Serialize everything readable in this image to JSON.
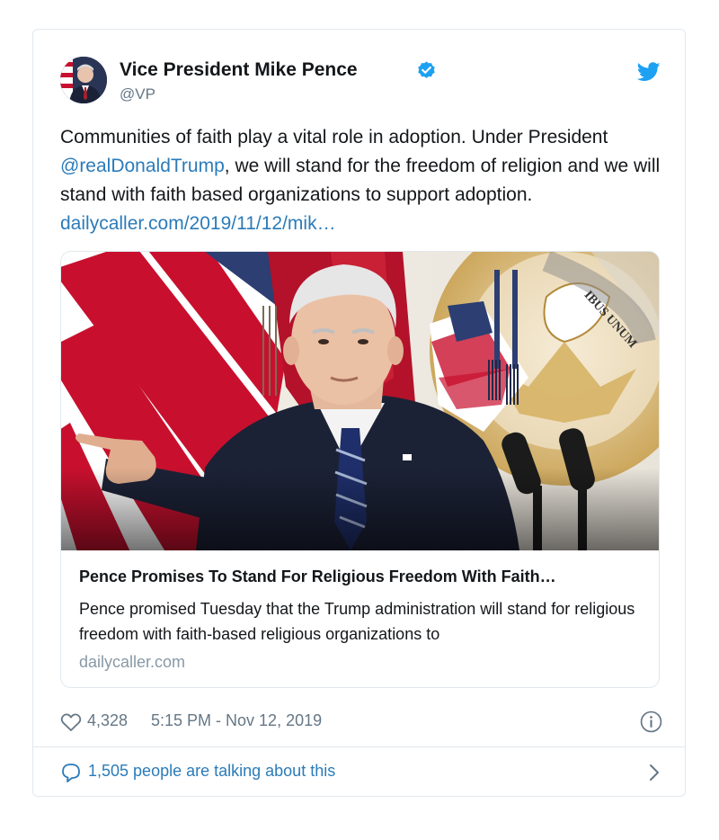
{
  "author": {
    "display_name": "Vice President Mike Pence",
    "handle": "@VP"
  },
  "tweet": {
    "text_part1": "Communities of faith play a vital role in adoption. Under President ",
    "mention": "@realDonaldTrump",
    "text_part2": ", we will stand for the freedom of religion and we will stand with faith based organizations to support adoption.  ",
    "link": "dailycaller.com/2019/11/12/mik…"
  },
  "card": {
    "title": "Pence Promises To Stand For Religious Freedom With Faith…",
    "description": "Pence promised Tuesday that the Trump administration will stand for religious freedom with faith-based religious organizations to",
    "domain": "dailycaller.com",
    "seal_text": "IBUS UNUM"
  },
  "meta": {
    "likes": "4,328",
    "timestamp": "5:15 PM - Nov 12, 2019"
  },
  "engagement": {
    "talking": "1,505 people are talking about this"
  },
  "colors": {
    "link": "#2b7bb9",
    "verified": "#1da1f2",
    "twitter_brand": "#1da1f2",
    "muted": "#657786",
    "border": "#e1e8ed"
  },
  "icons": {
    "verified": "verified-badge-icon",
    "brand": "twitter-bird-icon",
    "like": "heart-icon",
    "info": "info-icon",
    "reply": "speech-bubble-icon",
    "chevron": "chevron-right-icon"
  }
}
